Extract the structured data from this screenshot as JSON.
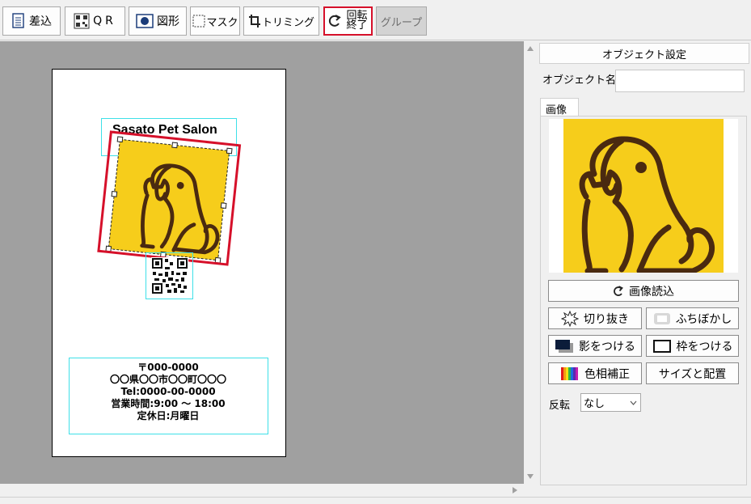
{
  "toolbar": {
    "insert_label": "差込",
    "qr_label": "QR",
    "shape_label": "図形",
    "mask_label": "マスク",
    "trim_label": "トリミング",
    "rotate_end_label": "回転\n終了",
    "group_label": "グループ"
  },
  "canvas": {
    "salon_name": "Sasato Pet Salon",
    "address_lines": [
      "〒000-0000",
      "〇〇県〇〇市〇〇町〇〇〇",
      "Tel:0000-00-0000",
      "営業時間:9:00 ～ 18:00",
      "定休日:月曜日"
    ]
  },
  "panel": {
    "header": "オブジェクト設定",
    "object_name_label": "オブジェクト名",
    "object_name_value": "",
    "image_tab": "画像",
    "load_image": "画像読込",
    "crop": "切り抜き",
    "blur_edges": "ふちぼかし",
    "add_shadow": "影をつける",
    "add_frame": "枠をつける",
    "color_correction": "色相補正",
    "size_position": "サイズと配置",
    "flip_label": "反転",
    "flip_value": "なし"
  },
  "colors": {
    "accent_red": "#d6102a",
    "image_yellow": "#f6cd1b",
    "image_line": "#4a2a10",
    "guide_cyan": "#3ee0e8"
  }
}
